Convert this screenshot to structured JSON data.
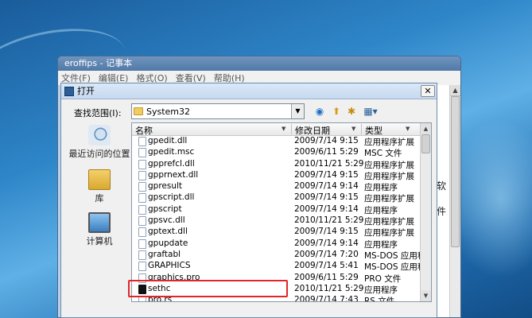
{
  "notepad": {
    "title": "eroffips - 记事本",
    "menu": [
      "文件(F)",
      "编辑(E)",
      "格式(O)",
      "查看(V)",
      "帮助(H)"
    ],
    "side_chars": [
      "软",
      "件"
    ],
    "scroll_up": "▲"
  },
  "dialog": {
    "title": "打开",
    "close": "✕",
    "look_in_label": "查找范围(I):",
    "look_in_value": "System32",
    "toolbar_icons": [
      "back-icon",
      "up-folder-icon",
      "new-folder-icon",
      "view-menu-icon"
    ],
    "places": [
      {
        "label": "最近访问的位置",
        "icon": "recent-places-icon"
      },
      {
        "label": "库",
        "icon": "library-icon"
      },
      {
        "label": "计算机",
        "icon": "computer-icon"
      }
    ],
    "columns": {
      "name": "名称",
      "date": "修改日期",
      "type": "类型"
    },
    "files": [
      {
        "name": "gpedit.dll",
        "date": "2009/7/14 9:15",
        "type": "应用程序扩展"
      },
      {
        "name": "gpedit.msc",
        "date": "2009/6/11 5:29",
        "type": "MSC 文件"
      },
      {
        "name": "gpprefcl.dll",
        "date": "2010/11/21 5:29",
        "type": "应用程序扩展"
      },
      {
        "name": "gpprnext.dll",
        "date": "2009/7/14 9:15",
        "type": "应用程序扩展"
      },
      {
        "name": "gpresult",
        "date": "2009/7/14 9:14",
        "type": "应用程序"
      },
      {
        "name": "gpscript.dll",
        "date": "2009/7/14 9:15",
        "type": "应用程序扩展"
      },
      {
        "name": "gpscript",
        "date": "2009/7/14 9:14",
        "type": "应用程序"
      },
      {
        "name": "gpsvc.dll",
        "date": "2010/11/21 5:29",
        "type": "应用程序扩展"
      },
      {
        "name": "gptext.dll",
        "date": "2009/7/14 9:15",
        "type": "应用程序扩展"
      },
      {
        "name": "gpupdate",
        "date": "2009/7/14 9:14",
        "type": "应用程序"
      },
      {
        "name": "graftabl",
        "date": "2009/7/14 7:20",
        "type": "MS-DOS 应用程序"
      },
      {
        "name": "GRAPHICS",
        "date": "2009/7/14 5:41",
        "type": "MS-DOS 应用程序"
      },
      {
        "name": "graphics.pro",
        "date": "2009/6/11 5:29",
        "type": "PRO 文件"
      },
      {
        "name": "sethc",
        "date": "2010/11/21 5:29",
        "type": "应用程序"
      },
      {
        "name": "pro.rs",
        "date": "2009/7/14 7:43",
        "type": "RS 文件"
      }
    ]
  }
}
